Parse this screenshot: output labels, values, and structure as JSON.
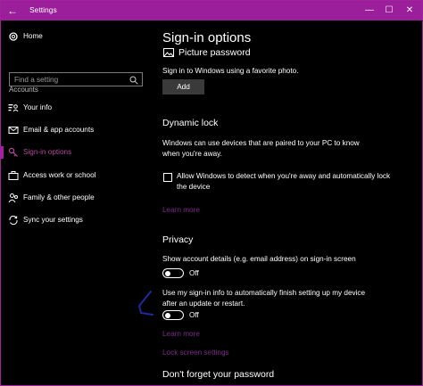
{
  "window": {
    "title": "Settings",
    "controls": [
      "minimize",
      "maximize",
      "close"
    ]
  },
  "sidebar": {
    "home_label": "Home",
    "search_placeholder": "Find a setting",
    "section_header": "Accounts",
    "items": [
      {
        "label": "Your info",
        "icon": "person-card-icon"
      },
      {
        "label": "Email & app accounts",
        "icon": "envelope-icon"
      },
      {
        "label": "Sign-in options",
        "icon": "key-icon",
        "active": true
      },
      {
        "label": "Access work or school",
        "icon": "briefcase-icon"
      },
      {
        "label": "Family & other people",
        "icon": "people-icon"
      },
      {
        "label": "Sync your settings",
        "icon": "sync-icon"
      }
    ]
  },
  "main": {
    "title": "Sign-in options",
    "picture_password": {
      "heading": "Picture password",
      "description": "Sign in to Windows using a favorite photo.",
      "button": "Add"
    },
    "dynamic_lock": {
      "heading": "Dynamic lock",
      "description": "Windows can use devices that are paired to your PC to know when you're away.",
      "checkbox_label": "Allow Windows to detect when you're away and automatically lock the device",
      "checked": false,
      "learn_more": "Learn more"
    },
    "privacy": {
      "heading": "Privacy",
      "setting1_label": "Show account details (e.g. email address) on sign-in screen",
      "setting1_state": "Off",
      "setting2_label": "Use my sign-in info to automatically finish setting up my device after an update or restart.",
      "setting2_state": "Off",
      "learn_more": "Learn more",
      "lock_screen_link": "Lock screen settings"
    },
    "forgot_heading": "Don't forget your password"
  },
  "colors": {
    "accent": "#9b1e9a",
    "link": "#7d2a8a",
    "background": "#000000",
    "annotation": "#1e2aa0"
  }
}
